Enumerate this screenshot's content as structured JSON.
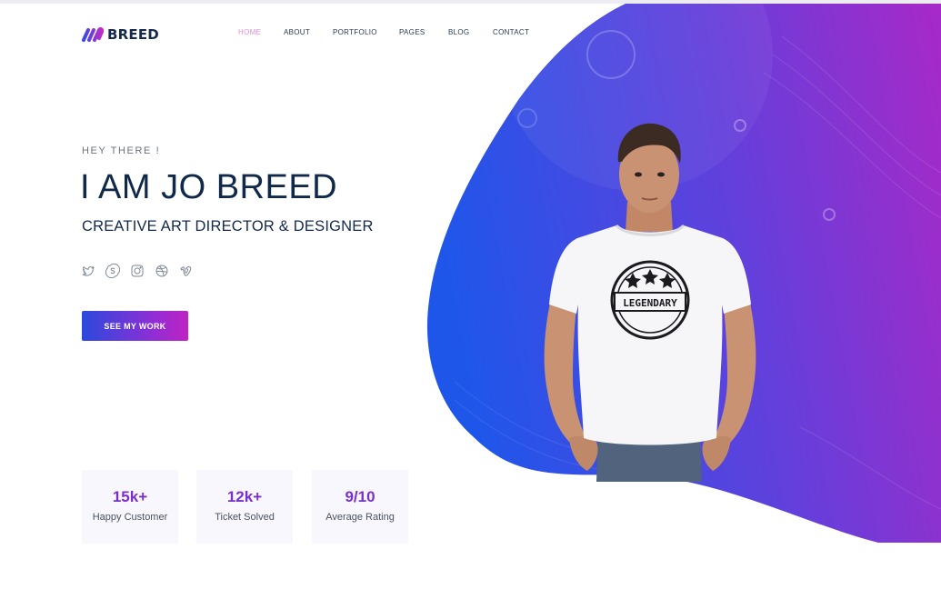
{
  "brand": {
    "name": "BREED",
    "accent": "#6a35d9"
  },
  "nav": {
    "items": [
      {
        "label": "HOME",
        "active": true
      },
      {
        "label": "ABOUT",
        "active": false
      },
      {
        "label": "PORTFOLIO",
        "active": false
      },
      {
        "label": "PAGES",
        "active": false
      },
      {
        "label": "BLOG",
        "active": false
      },
      {
        "label": "CONTACT",
        "active": false
      }
    ]
  },
  "hero": {
    "eyebrow": "HEY THERE !",
    "title": "I AM JO BREED",
    "subtitle": "CREATIVE ART DIRECTOR & DESIGNER",
    "cta_label": "SEE MY WORK",
    "socials": [
      "twitter-icon",
      "skype-icon",
      "instagram-icon",
      "dribbble-icon",
      "vimeo-icon"
    ],
    "tshirt_text": "LEGENDARY",
    "gradient": {
      "start": "#1f56ea",
      "mid": "#6b3ed9",
      "end": "#a52ac8"
    }
  },
  "stats": [
    {
      "value": "15k+",
      "label": "Happy Customer"
    },
    {
      "value": "12k+",
      "label": "Ticket Solved"
    },
    {
      "value": "9/10",
      "label": "Average Rating"
    }
  ]
}
